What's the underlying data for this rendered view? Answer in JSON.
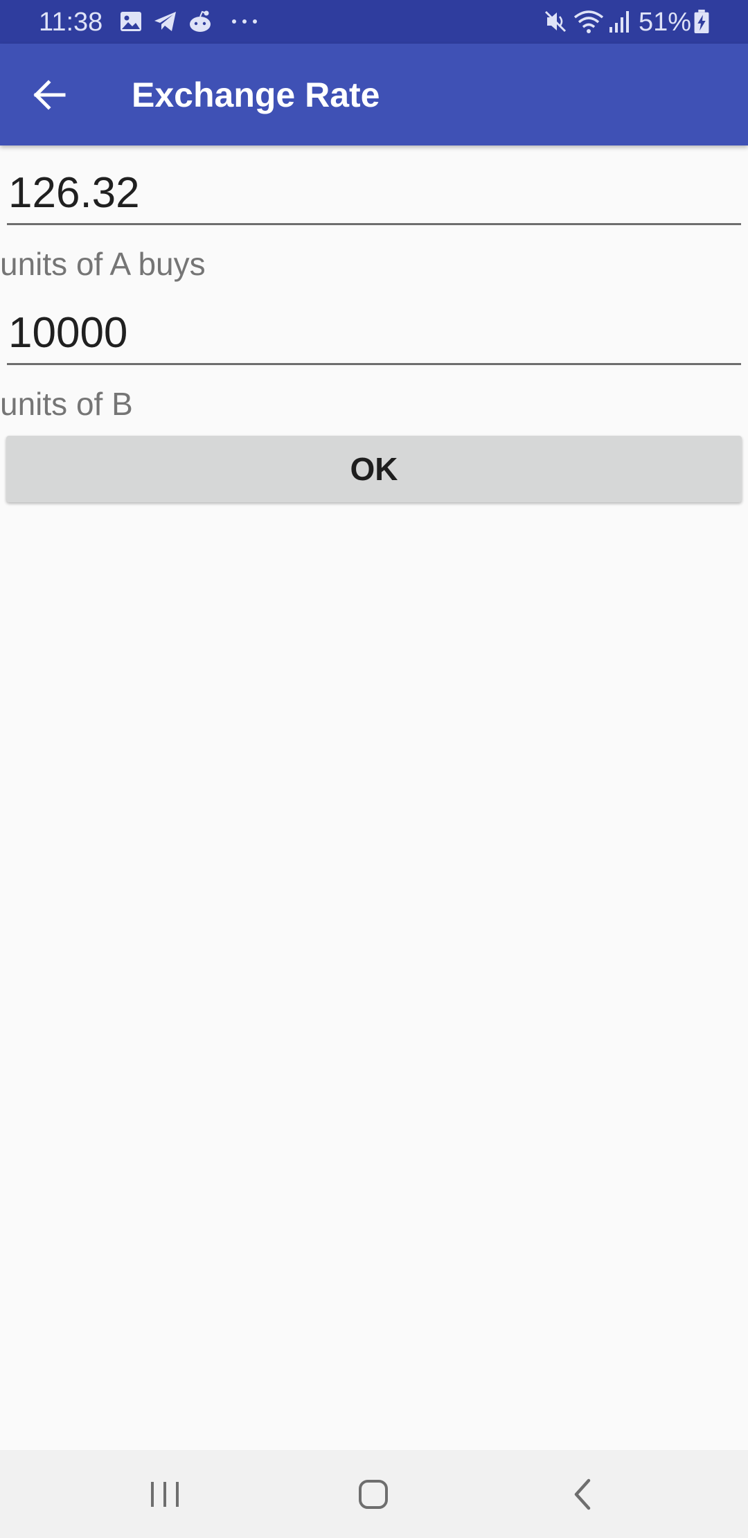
{
  "status_bar": {
    "time": "11:38",
    "battery": "51%",
    "icons": [
      "image-icon",
      "telegram-icon",
      "reddit-icon",
      "more-dots-icon",
      "mute-icon",
      "wifi-icon",
      "signal-icon",
      "battery-charging-icon"
    ]
  },
  "app_bar": {
    "title": "Exchange Rate",
    "back_icon": "arrow-back-icon",
    "color": "#3f51b5"
  },
  "form": {
    "amount_a": "126.32",
    "label_a": "units of A buys",
    "amount_b": "10000",
    "label_b": "units of B",
    "ok_label": "OK"
  },
  "nav_bar": {
    "icons": [
      "recent-apps-icon",
      "home-icon",
      "back-icon"
    ]
  }
}
